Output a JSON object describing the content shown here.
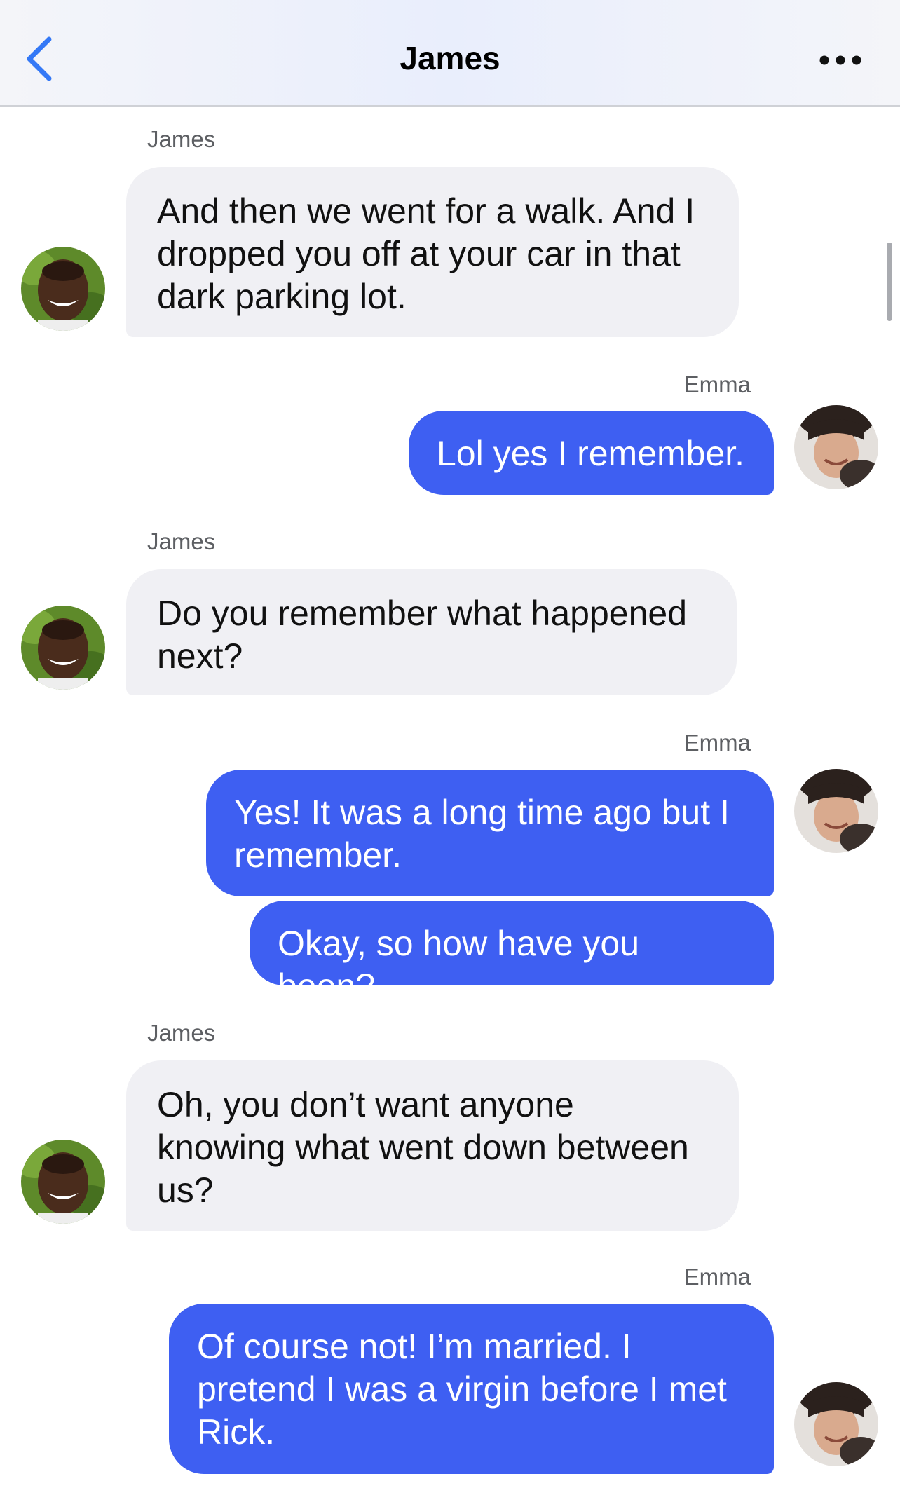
{
  "header": {
    "title": "James",
    "back_icon": "chevron-left-icon",
    "more_icon": "ellipsis-icon",
    "accent": "#3478f6"
  },
  "colors": {
    "outgoing_bubble": "#3e5ff2",
    "incoming_bubble": "#f0f0f4"
  },
  "messages": [
    {
      "sender": "James",
      "direction": "incoming",
      "text": "And then we went for a walk. And I dropped you off at your car in that dark parking lot."
    },
    {
      "sender": "Emma",
      "direction": "outgoing",
      "text": "Lol yes I remember."
    },
    {
      "sender": "James",
      "direction": "incoming",
      "text": "Do you remember what happened next?"
    },
    {
      "sender": "Emma",
      "direction": "outgoing",
      "text": "Yes! It was a long time ago but I remember."
    },
    {
      "sender": "Emma",
      "direction": "outgoing",
      "text": "Okay, so how have you been?"
    },
    {
      "sender": "James",
      "direction": "incoming",
      "text": "Oh, you don’t want anyone knowing what went down between us?"
    },
    {
      "sender": "Emma",
      "direction": "outgoing",
      "text": "Of course not! I’m married. I pretend I was a virgin before I met Rick."
    }
  ]
}
